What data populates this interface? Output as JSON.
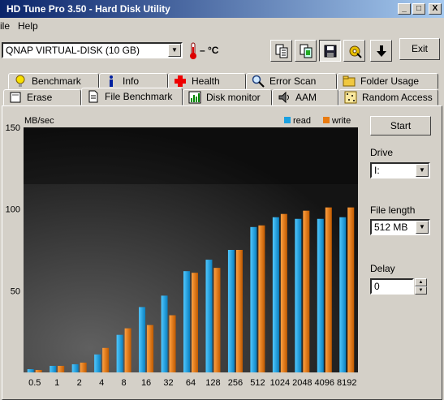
{
  "window": {
    "title": "HD Tune Pro 3.50 - Hard Disk Utility",
    "buttons": [
      "_",
      "□",
      "X"
    ]
  },
  "menu": {
    "items": [
      "ile",
      "Help"
    ]
  },
  "toolbar": {
    "drive": "QNAP    VIRTUAL-DISK (10 GB)",
    "temperature": "– °C",
    "exit_label": "Exit",
    "icons": [
      "copy-text-icon",
      "copy-info-icon",
      "save-icon",
      "options-icon",
      "download-icon"
    ]
  },
  "tabs": {
    "row1": [
      "Benchmark",
      "Info",
      "Health",
      "Error Scan",
      "Folder Usage"
    ],
    "row2": [
      "Erase",
      "File Benchmark",
      "Disk monitor",
      "AAM",
      "Random Access"
    ],
    "active": "File Benchmark"
  },
  "controls": {
    "start_label": "Start",
    "drive_label": "Drive",
    "drive_value": "I:",
    "file_length_label": "File length",
    "file_length_value": "512 MB",
    "delay_label": "Delay",
    "delay_value": "0"
  },
  "colors": {
    "read": "#1aa0e0",
    "write": "#e87a10"
  },
  "chart_data": {
    "type": "bar",
    "ylabel": "MB/sec",
    "ylim": [
      0,
      150
    ],
    "yticks": [
      50,
      100,
      150
    ],
    "categories": [
      "0.5",
      "1",
      "2",
      "4",
      "8",
      "16",
      "32",
      "64",
      "128",
      "256",
      "512",
      "1024",
      "2048",
      "4096",
      "8192"
    ],
    "series": [
      {
        "name": "read",
        "values": [
          2,
          4,
          5,
          11,
          23,
          40,
          47,
          62,
          69,
          75,
          89,
          95,
          94,
          94,
          95
        ]
      },
      {
        "name": "write",
        "values": [
          1.5,
          4,
          6,
          15,
          27,
          29,
          35,
          61,
          64,
          75,
          90,
          97,
          99,
          101,
          101
        ]
      }
    ],
    "legend": "top-right",
    "grid": false
  }
}
